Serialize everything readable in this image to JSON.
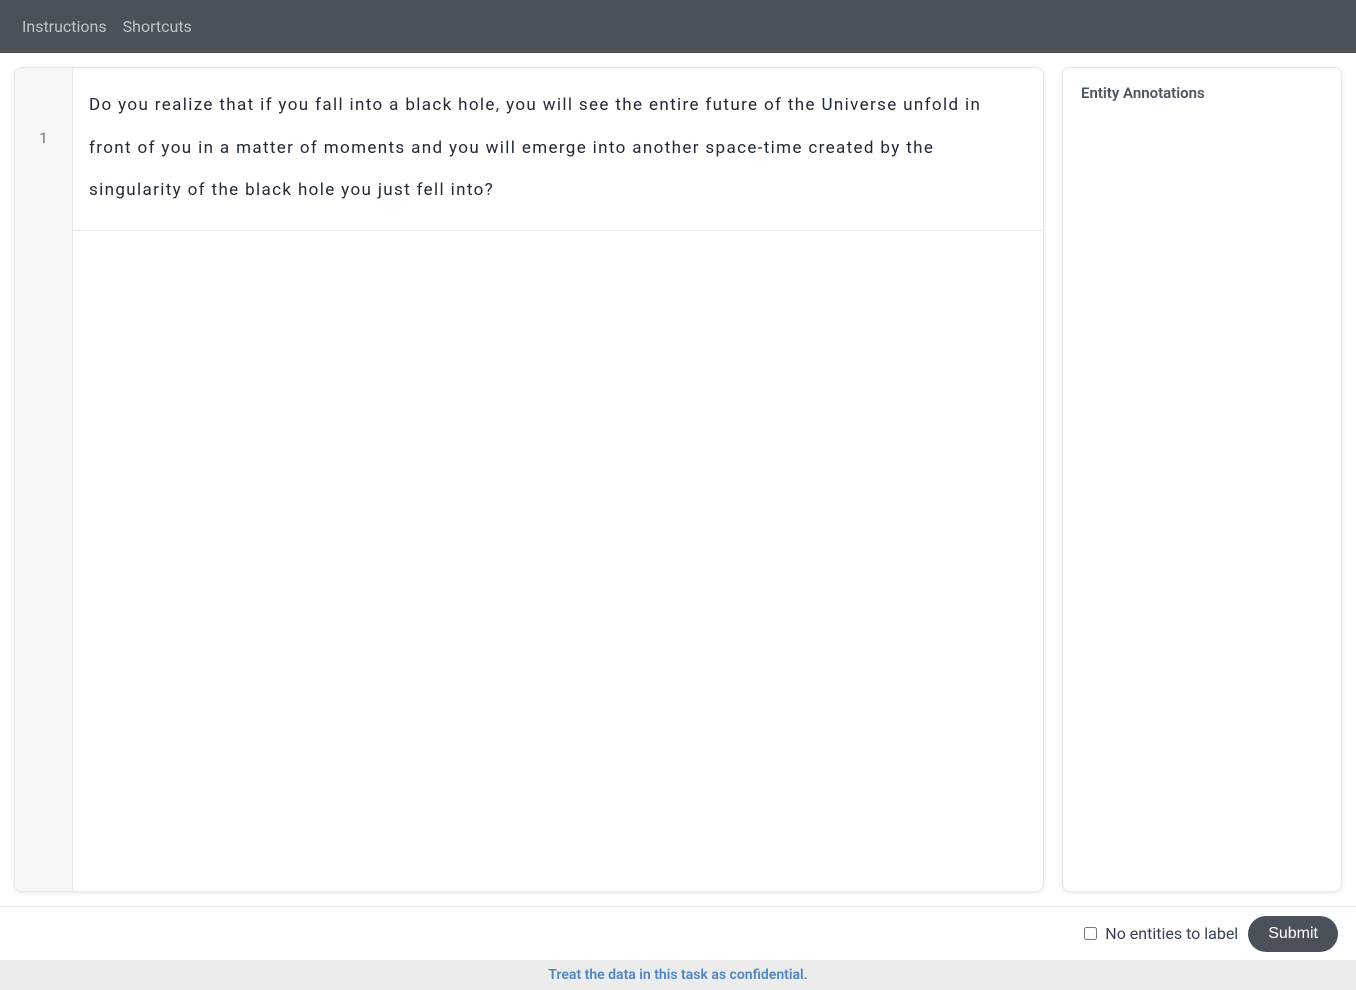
{
  "header": {
    "instructions_label": "Instructions",
    "shortcuts_label": "Shortcuts"
  },
  "text_panel": {
    "lines": [
      {
        "number": "1",
        "text": "Do you realize that if you fall into a black hole, you will see the entire future of the Universe unfold in front of you in a matter of moments and you will emerge into another space-time created by the singularity of the black hole you just fell into?"
      }
    ]
  },
  "side_panel": {
    "title": "Entity Annotations"
  },
  "bottom_bar": {
    "no_entities_label": "No entities to label",
    "submit_label": "Submit"
  },
  "footer": {
    "notice": "Treat the data in this task as confidential."
  }
}
